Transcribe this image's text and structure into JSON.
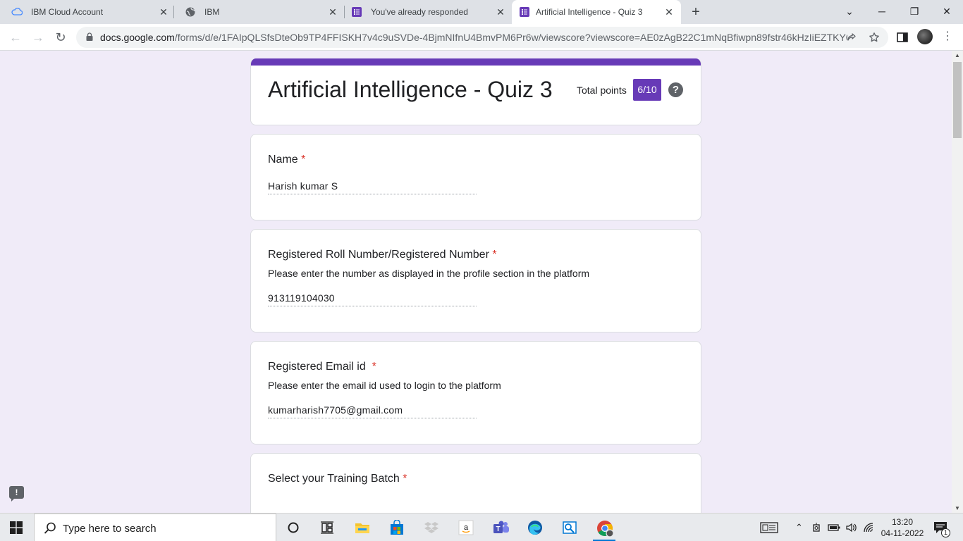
{
  "browser": {
    "tabs": [
      {
        "title": "IBM Cloud Account",
        "icon": "cloud-icon"
      },
      {
        "title": "IBM",
        "icon": "globe-icon"
      },
      {
        "title": "You've already responded",
        "icon": "google-forms-icon"
      },
      {
        "title": "Artificial Intelligence - Quiz 3",
        "icon": "google-forms-icon",
        "active": true
      }
    ],
    "new_tab": "+",
    "url": {
      "host": "docs.google.com",
      "path": "/forms/d/e/1FAIpQLSfsDteOb9TP4FFISKH7v4c9uSVDe-4BjmNIfnU4BmvPM6Pr6w/viewscore?viewscore=AE0zAgB22C1mNqBfiwpn89fstr46kHzIiEZTKY6..."
    }
  },
  "form": {
    "title": "Artificial Intelligence - Quiz 3",
    "total_points_label": "Total points",
    "total_points": "6/10",
    "help": "?",
    "questions": [
      {
        "title": "Name",
        "required": "*",
        "description": "",
        "answer": "Harish kumar S"
      },
      {
        "title": "Registered Roll Number/Registered Number",
        "required": "*",
        "description": "Please enter the number as displayed in the profile section in the platform",
        "answer": "913119104030"
      },
      {
        "title": "Registered Email id ",
        "required": "*",
        "description": "Please enter the email id used to login to the platform",
        "answer": "kumarharish7705@gmail.com"
      },
      {
        "title": "Select your Training Batch",
        "required": "*",
        "description": "",
        "answer": ""
      }
    ],
    "feedback": "!"
  },
  "taskbar": {
    "search_placeholder": "Type here to search",
    "time": "13:20",
    "date": "04-11-2022",
    "notification_count": "1"
  },
  "colors": {
    "accent": "#673ab7",
    "background": "#f0ebf8",
    "required": "#d93025"
  }
}
